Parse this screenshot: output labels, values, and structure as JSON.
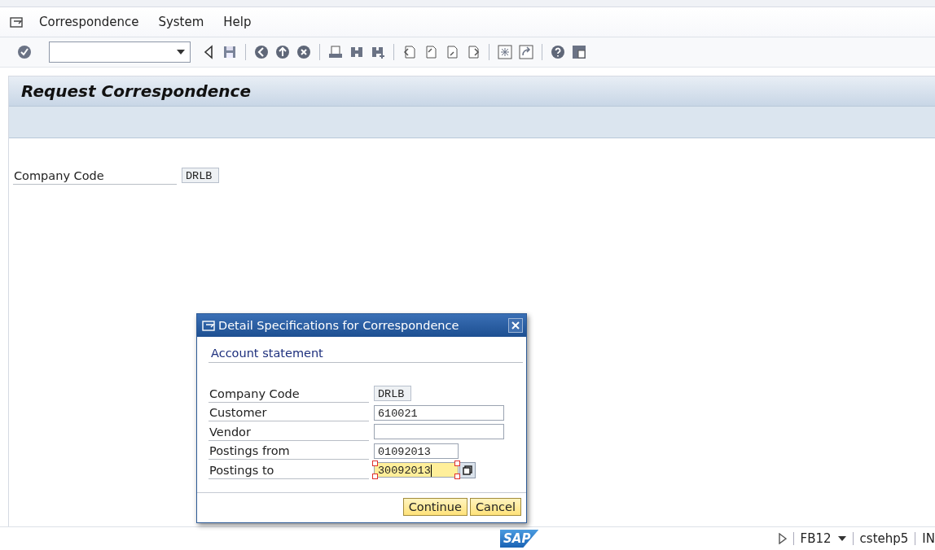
{
  "menu_bar": {
    "items": [
      "Correspondence",
      "System",
      "Help"
    ]
  },
  "toolbar": {
    "command_field": {
      "kind": "combo"
    }
  },
  "screen": {
    "title": "Request Correspondence",
    "fields": [
      {
        "label": "Company Code",
        "value": "DRLB",
        "kind": "display"
      }
    ]
  },
  "dialog": {
    "title": "Detail Specifications for Correspondence",
    "section": "Account statement",
    "fields": [
      {
        "label": "Company Code",
        "value": "DRLB",
        "kind": "display",
        "focused": false
      },
      {
        "label": "Customer",
        "value": "610021",
        "kind": "input",
        "focused": false
      },
      {
        "label": "Vendor",
        "kind": "input",
        "focused": false
      },
      {
        "label": "Postings from",
        "value": "01092013",
        "kind": "short",
        "focused": false
      },
      {
        "label": "Postings to",
        "value": "30092013",
        "kind": "short",
        "focused": true
      }
    ],
    "buttons": [
      "Continue",
      "Cancel"
    ]
  },
  "status_bar": {
    "logo": "SAP",
    "items": [
      "FB12",
      "cstehp5",
      "IN"
    ]
  }
}
